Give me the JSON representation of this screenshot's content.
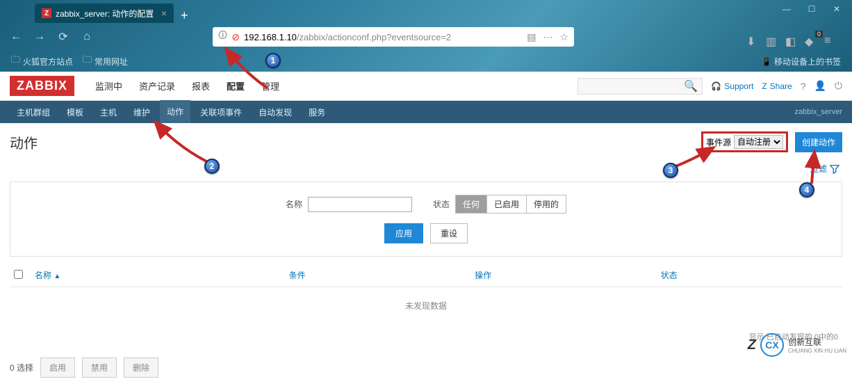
{
  "browser": {
    "tab_title": "zabbix_server: 动作的配置",
    "tab_favicon": "Z",
    "url_ip": "192.168.1.10",
    "url_path": "/zabbix/actionconf.php?eventsource=2",
    "bookmarks": [
      "火狐官方站点",
      "常用网址"
    ],
    "mobile_bookmarks": "移动设备上的书签",
    "ext_count": "0"
  },
  "zabbix": {
    "logo": "ZABBIX",
    "main_nav": [
      "监测中",
      "资产记录",
      "报表",
      "配置",
      "管理"
    ],
    "main_nav_active": 3,
    "support": "Support",
    "share": "Share",
    "sub_nav": [
      "主机群组",
      "模板",
      "主机",
      "维护",
      "动作",
      "关联项事件",
      "自动发现",
      "服务"
    ],
    "sub_nav_active": 4,
    "server_name": "zabbix_server"
  },
  "page": {
    "title": "动作",
    "event_source_label": "事件源",
    "event_source_value": "自动注册",
    "create_btn": "创建动作",
    "filter_link": "过滤"
  },
  "filter": {
    "name_label": "名称",
    "name_value": "",
    "status_label": "状态",
    "status_options": [
      "任何",
      "已启用",
      "停用的"
    ],
    "status_active": 0,
    "apply": "应用",
    "reset": "重设"
  },
  "table": {
    "headers": [
      "名称",
      "条件",
      "操作",
      "状态"
    ],
    "sort_col": 0,
    "no_data": "未发现数据",
    "footer": "显示 已自动发现的 0中的0"
  },
  "bottom": {
    "selected": "0 选择",
    "enable": "启用",
    "disable": "禁用",
    "delete": "删除"
  },
  "callouts": [
    "1",
    "2",
    "3",
    "4"
  ],
  "corner": {
    "brand": "创新互联",
    "sub": "CHUANG XIN HU LIAN"
  }
}
